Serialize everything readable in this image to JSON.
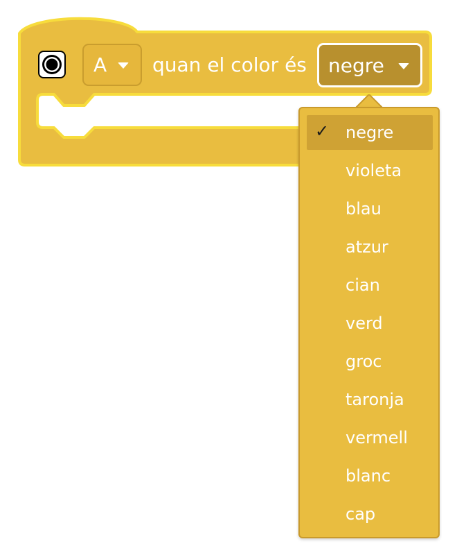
{
  "block": {
    "port_value": "A",
    "label": "quan el color és",
    "color_value": "negre"
  },
  "icons": {
    "sensor": "color-sensor-icon",
    "port_arrow": "chevron-down-icon",
    "color_arrow": "chevron-down-icon",
    "check": "checkmark-icon"
  },
  "menu": {
    "check_mark": "✓",
    "items": [
      {
        "label": "negre",
        "selected": true
      },
      {
        "label": "violeta",
        "selected": false
      },
      {
        "label": "blau",
        "selected": false
      },
      {
        "label": "atzur",
        "selected": false
      },
      {
        "label": "cian",
        "selected": false
      },
      {
        "label": "verd",
        "selected": false
      },
      {
        "label": "groc",
        "selected": false
      },
      {
        "label": "taronja",
        "selected": false
      },
      {
        "label": "vermell",
        "selected": false
      },
      {
        "label": "blanc",
        "selected": false
      },
      {
        "label": "cap",
        "selected": false
      }
    ]
  },
  "colors": {
    "block_fill": "#e9bd40",
    "block_border": "#f7dc3c",
    "selected_field": "#b8902e",
    "menu_fill": "#e9bd40",
    "menu_selected": "#cfa234",
    "text": "#ffffff"
  }
}
